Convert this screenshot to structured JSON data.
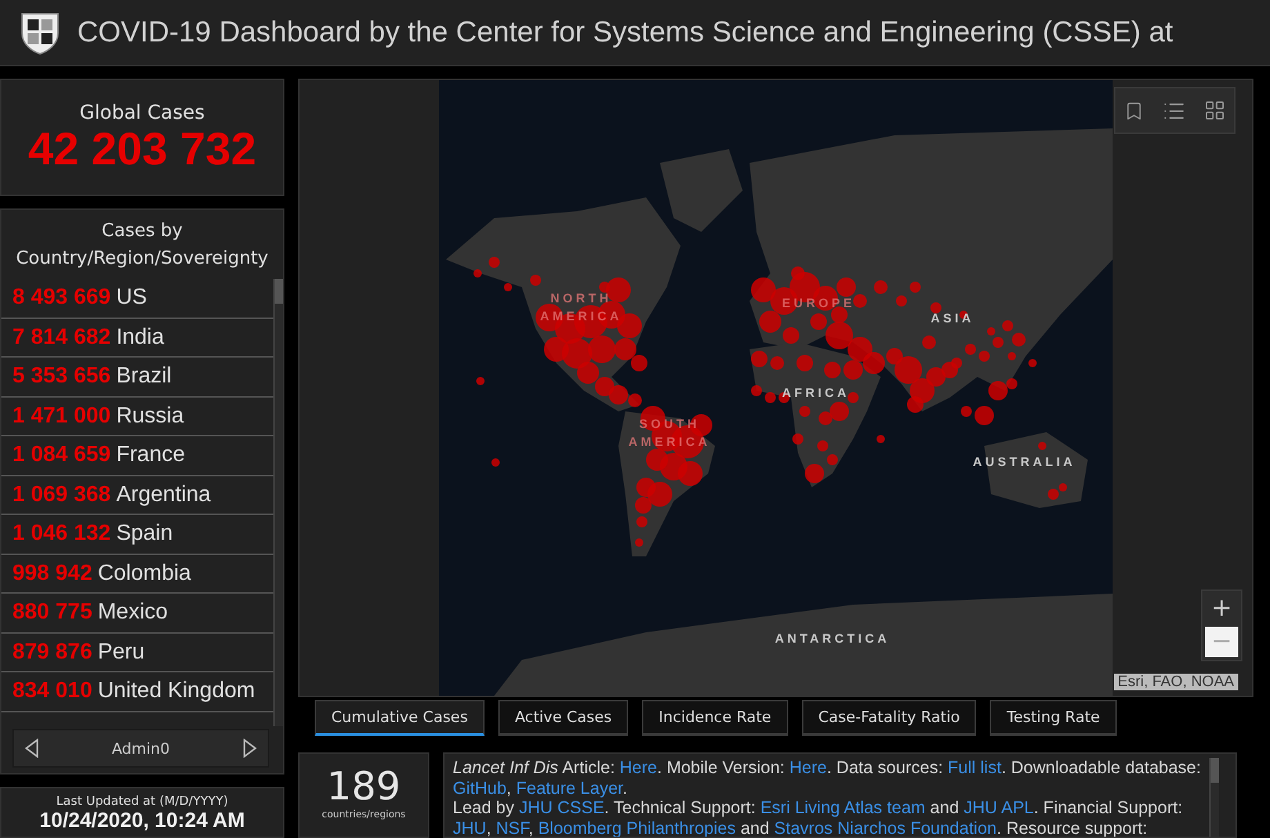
{
  "header": {
    "title": "COVID-19 Dashboard by the Center for Systems Science and Engineering (CSSE) at"
  },
  "global_cases": {
    "label": "Global Cases",
    "value": "42 203 732"
  },
  "country_list": {
    "title": "Cases by Country/Region/Sovereignty",
    "rows": [
      {
        "count": "8 493 669",
        "name": "US"
      },
      {
        "count": "7 814 682",
        "name": "India"
      },
      {
        "count": "5 353 656",
        "name": "Brazil"
      },
      {
        "count": "1 471 000",
        "name": "Russia"
      },
      {
        "count": "1 084 659",
        "name": "France"
      },
      {
        "count": "1 069 368",
        "name": "Argentina"
      },
      {
        "count": "1 046 132",
        "name": "Spain"
      },
      {
        "count": "998 942",
        "name": "Colombia"
      },
      {
        "count": "880 775",
        "name": "Mexico"
      },
      {
        "count": "879 876",
        "name": "Peru"
      },
      {
        "count": "834 010",
        "name": "United Kingdom"
      }
    ],
    "pager": "Admin0"
  },
  "last_updated": {
    "label": "Last Updated at (M/D/YYYY)",
    "value": "10/24/2020, 10:24 AM"
  },
  "map": {
    "labels": [
      "NORTH AMERICA",
      "EUROPE",
      "ASIA",
      "AFRICA",
      "SOUTH AMERICA",
      "AUSTRALIA",
      "ANTARCTICA"
    ],
    "zoom": [
      {
        "label": "+",
        "highlighted": false
      },
      {
        "label": "−",
        "highlighted": true
      }
    ],
    "attribution": "Esri, FAO, NOAA"
  },
  "tabs": [
    {
      "label": "Cumulative Cases",
      "selected": true
    },
    {
      "label": "Active Cases",
      "selected": false
    },
    {
      "label": "Incidence Rate",
      "selected": false
    },
    {
      "label": "Case-Fatality Ratio",
      "selected": false
    },
    {
      "label": "Testing Rate",
      "selected": false
    }
  ],
  "country_count": {
    "value": "189",
    "label": "countries/regions"
  },
  "info": {
    "paragraphs": [
      [
        {
          "kind": "text",
          "text": "*Lancet Inf Dis* Article: "
        },
        {
          "kind": "link",
          "text": "Here"
        },
        {
          "kind": "text",
          "text": ". Mobile Version: "
        },
        {
          "kind": "link",
          "text": "Here"
        },
        {
          "kind": "text",
          "text": ". Data sources: "
        },
        {
          "kind": "link",
          "text": "Full list"
        },
        {
          "kind": "text",
          "text": ". Downloadable database: "
        },
        {
          "kind": "link",
          "text": "GitHub"
        },
        {
          "kind": "text",
          "text": ", "
        },
        {
          "kind": "link",
          "text": "Feature Layer"
        },
        {
          "kind": "text",
          "text": "."
        }
      ],
      [
        {
          "kind": "text",
          "text": "Lead by "
        },
        {
          "kind": "link",
          "text": "JHU CSSE"
        },
        {
          "kind": "text",
          "text": ". Technical Support: "
        },
        {
          "kind": "link",
          "text": "Esri Living Atlas team"
        },
        {
          "kind": "text",
          "text": " and "
        },
        {
          "kind": "link",
          "text": "JHU APL"
        },
        {
          "kind": "text",
          "text": ". Financial Support: "
        },
        {
          "kind": "link",
          "text": "JHU"
        },
        {
          "kind": "text",
          "text": ", "
        },
        {
          "kind": "link",
          "text": "NSF"
        },
        {
          "kind": "text",
          "text": ", "
        },
        {
          "kind": "link",
          "text": "Bloomberg Philanthropies"
        },
        {
          "kind": "text",
          "text": " and "
        },
        {
          "kind": "link",
          "text": "Stavros Niarchos Foundation"
        },
        {
          "kind": "text",
          "text": ". Resource support:"
        }
      ]
    ]
  }
}
